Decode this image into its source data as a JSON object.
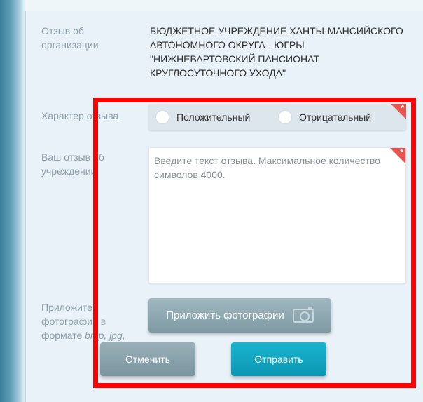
{
  "form": {
    "org_label": "Отзыв об организации",
    "org_name": "БЮДЖЕТНОЕ УЧРЕЖДЕНИЕ ХАНТЫ-МАНСИЙСКОГО АВТОНОМНОГО ОКРУГА - ЮГРЫ \"НИЖНЕВАРТОВСКИЙ ПАНСИОНАТ КРУГЛОСУТОЧНОГО УХОДА\"",
    "nature_label": "Характер отзыва",
    "options": [
      "Положительный",
      "Отрицательный"
    ],
    "review_label": "Ваш отзыв об учреждении",
    "review_placeholder": "Введите текст отзыва. Максимальное количество символов 4000.",
    "photo_label_1": "Приложите",
    "photo_label_2": "фотографии в",
    "photo_label_3": "формате ",
    "photo_formats": "bmp, jpg,",
    "attach_button": "Приложить фотографии",
    "cancel_button": "Отменить",
    "send_button": "Отправить",
    "required_mark": "*"
  },
  "colors": {
    "required": "#e8534f",
    "send": "#0fa6c1",
    "highlight": "#ff0000"
  }
}
